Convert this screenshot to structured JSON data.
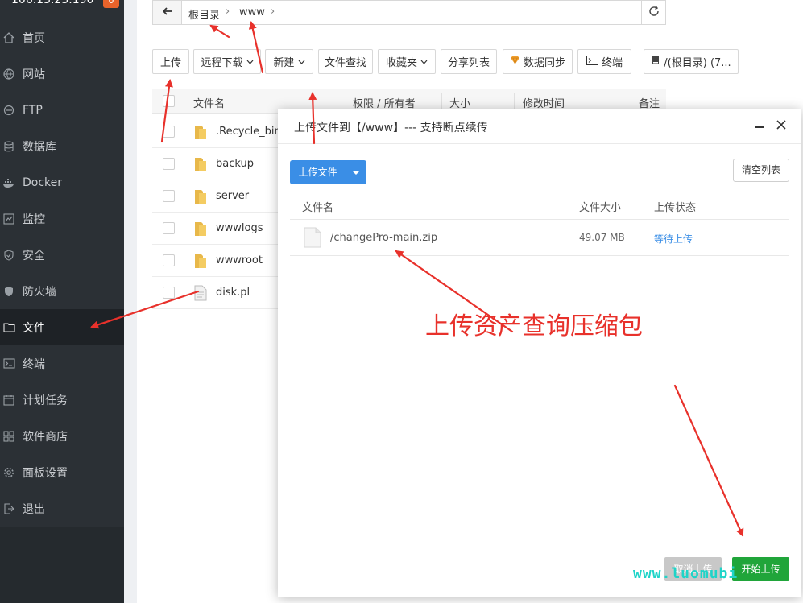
{
  "sidebar": {
    "ip": "106.13.23.190",
    "badge": "0",
    "items": [
      {
        "label": "首页",
        "icon": "home-icon"
      },
      {
        "label": "网站",
        "icon": "globe-icon"
      },
      {
        "label": "FTP",
        "icon": "ftp-icon"
      },
      {
        "label": "数据库",
        "icon": "database-icon"
      },
      {
        "label": "Docker",
        "icon": "docker-icon"
      },
      {
        "label": "监控",
        "icon": "monitor-icon"
      },
      {
        "label": "安全",
        "icon": "shield-icon"
      },
      {
        "label": "防火墙",
        "icon": "firewall-icon"
      },
      {
        "label": "文件",
        "icon": "folder-icon"
      },
      {
        "label": "终端",
        "icon": "terminal-icon"
      },
      {
        "label": "计划任务",
        "icon": "calendar-icon"
      },
      {
        "label": "软件商店",
        "icon": "apps-icon"
      },
      {
        "label": "面板设置",
        "icon": "gear-icon"
      },
      {
        "label": "退出",
        "icon": "logout-icon"
      }
    ],
    "active_index": 8
  },
  "path": {
    "crumbs": [
      "根目录",
      "www"
    ]
  },
  "toolbar": {
    "upload": "上传",
    "remote_download": "远程下载",
    "new": "新建",
    "file_search": "文件查找",
    "favorites": "收藏夹",
    "share_list": "分享列表",
    "data_sync": "数据同步",
    "terminal": "终端",
    "disk": "/(根目录) (7..."
  },
  "table": {
    "headers": {
      "name": "文件名",
      "perm": "权限 / 所有者",
      "size": "大小",
      "mtime": "修改时间",
      "note": "备注"
    },
    "rows": [
      {
        "name": ".Recycle_bin",
        "type": "folder"
      },
      {
        "name": "backup",
        "type": "folder"
      },
      {
        "name": "server",
        "type": "folder"
      },
      {
        "name": "wwwlogs",
        "type": "folder"
      },
      {
        "name": "wwwroot",
        "type": "folder"
      },
      {
        "name": "disk.pl",
        "type": "file"
      }
    ]
  },
  "dialog": {
    "title": "上传文件到【/www】--- 支持断点续传",
    "upload_button": "上传文件",
    "clear_button": "清空列表",
    "headers": {
      "name": "文件名",
      "size": "文件大小",
      "status": "上传状态"
    },
    "files": [
      {
        "name": "/changePro-main.zip",
        "size": "49.07 MB",
        "status": "等待上传"
      }
    ],
    "cancel_button": "取消上传",
    "start_button": "开始上传"
  },
  "annotation": "上传资产查询压缩包",
  "watermark": "www.luomubi",
  "colors": {
    "primary": "#3a8ee6",
    "success": "#20a53a",
    "annotation": "#e8312b",
    "sidebar": "#2b3035"
  }
}
